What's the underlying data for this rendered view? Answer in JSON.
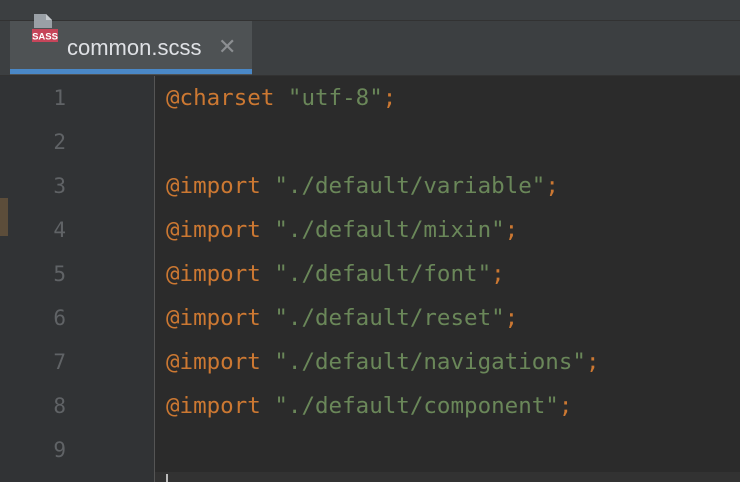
{
  "tab": {
    "icon_label": "SASS",
    "title": "common.scss",
    "close": "✕"
  },
  "lines": [
    {
      "num": "1",
      "kw": "@charset",
      "str": "\"utf-8\"",
      "semi": ";"
    },
    {
      "num": "2",
      "kw": "",
      "str": "",
      "semi": ""
    },
    {
      "num": "3",
      "kw": "@import",
      "str": "\"./default/variable\"",
      "semi": ";"
    },
    {
      "num": "4",
      "kw": "@import",
      "str": "\"./default/mixin\"",
      "semi": ";"
    },
    {
      "num": "5",
      "kw": "@import",
      "str": "\"./default/font\"",
      "semi": ";"
    },
    {
      "num": "6",
      "kw": "@import",
      "str": "\"./default/reset\"",
      "semi": ";"
    },
    {
      "num": "7",
      "kw": "@import",
      "str": "\"./default/navigations\"",
      "semi": ";"
    },
    {
      "num": "8",
      "kw": "@import",
      "str": "\"./default/component\"",
      "semi": ";"
    },
    {
      "num": "9",
      "kw": "",
      "str": "",
      "semi": ""
    }
  ],
  "colors": {
    "keyword": "#cc7832",
    "string": "#6a8759",
    "line_number": "#606366",
    "tab_underline": "#4a88c7",
    "background": "#2b2b2b"
  }
}
